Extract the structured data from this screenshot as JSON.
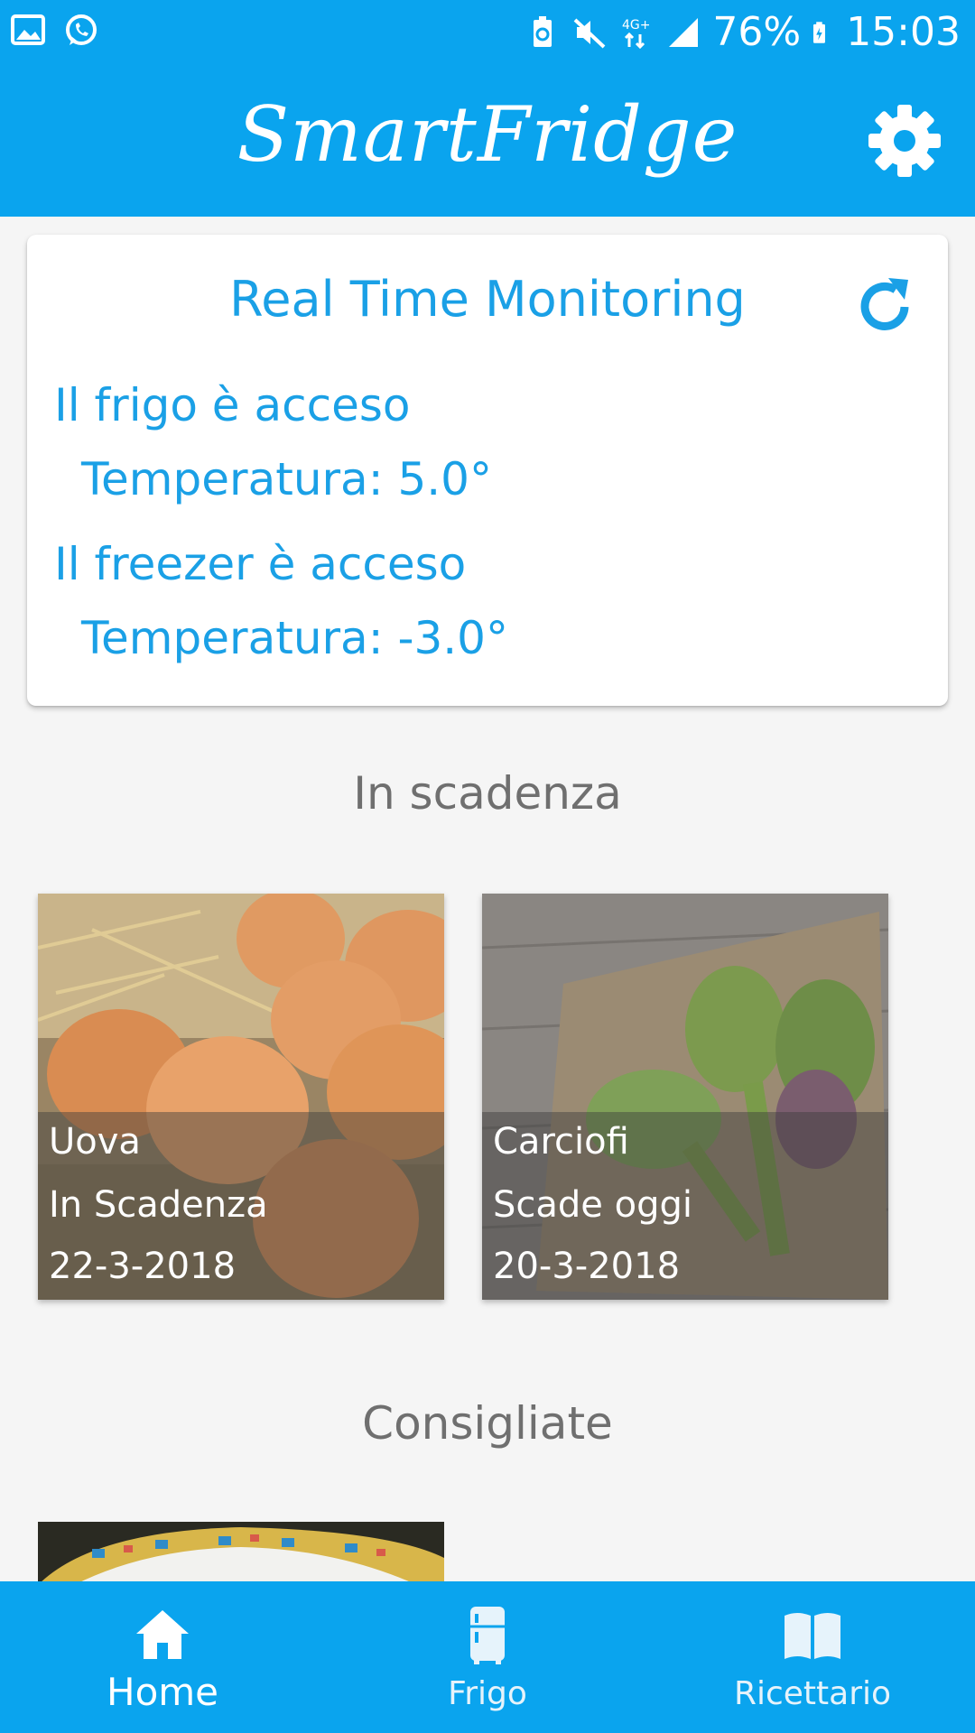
{
  "status_bar": {
    "battery_percent": "76%",
    "time": "15:03",
    "network": "4G+"
  },
  "app_bar": {
    "title": "SmartFridge"
  },
  "monitor": {
    "title": "Real Time Monitoring",
    "fridge_status": "Il frigo è acceso",
    "fridge_temp": "Temperatura: 5.0°",
    "freezer_status": "Il freezer è acceso",
    "freezer_temp": "Temperatura: -3.0°"
  },
  "expiring": {
    "title": "In scadenza",
    "items": [
      {
        "name": "Uova",
        "status": "In Scadenza",
        "date": "22-3-2018"
      },
      {
        "name": "Carciofi",
        "status": "Scade oggi",
        "date": "20-3-2018"
      }
    ]
  },
  "recommended": {
    "title": "Consigliate"
  },
  "bottom_nav": {
    "items": [
      {
        "label": "Home",
        "icon": "home-icon"
      },
      {
        "label": "Frigo",
        "icon": "fridge-icon"
      },
      {
        "label": "Ricettario",
        "icon": "book-icon"
      }
    ]
  },
  "colors": {
    "primary": "#0aa4ee",
    "accent_text": "#1aa0e6",
    "section_text": "#6f6f6f"
  }
}
